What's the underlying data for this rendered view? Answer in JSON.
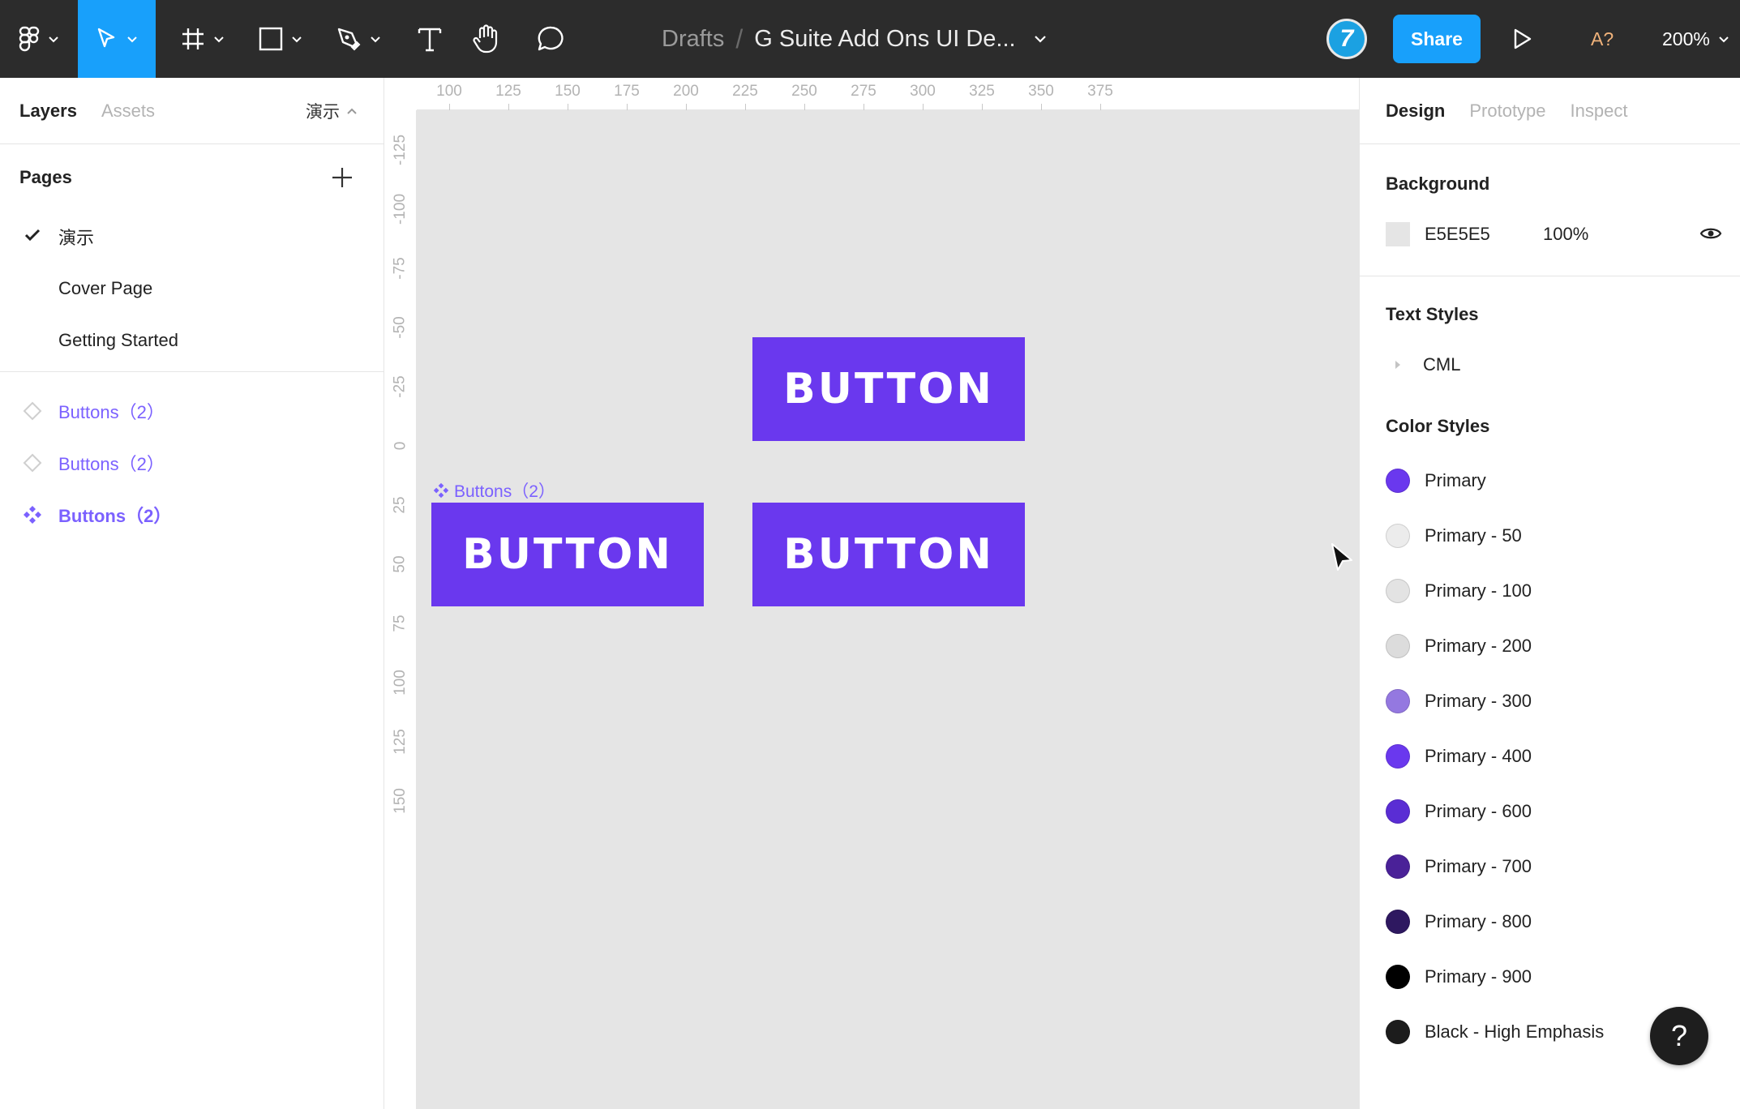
{
  "toolbar": {
    "breadcrumb_root": "Drafts",
    "breadcrumb_sep": "/",
    "document_title": "G Suite Add Ons UI De...",
    "avatar_initial": "7",
    "share_label": "Share",
    "a11y_label": "A?",
    "zoom_label": "200%",
    "icons": [
      "figma-menu-icon",
      "move-tool-icon",
      "frame-tool-icon",
      "shape-tool-icon",
      "pen-tool-icon",
      "text-tool-icon",
      "hand-tool-icon",
      "comment-tool-icon"
    ]
  },
  "left_panel": {
    "tabs": [
      "Layers",
      "Assets"
    ],
    "current_page_label": "演示",
    "pages_title": "Pages",
    "pages": [
      {
        "label": "演示",
        "selected": true
      },
      {
        "label": "Cover Page",
        "selected": false
      },
      {
        "label": "Getting Started",
        "selected": false
      }
    ],
    "layers": [
      {
        "label": "Buttons（2）",
        "icon": "component-variant-icon"
      },
      {
        "label": "Buttons（2）",
        "icon": "component-variant-icon"
      },
      {
        "label": "Buttons（2）",
        "icon": "component-set-icon"
      }
    ]
  },
  "canvas": {
    "ruler_x": [
      "100",
      "125",
      "150",
      "175",
      "200",
      "225",
      "250",
      "275",
      "300",
      "325",
      "350",
      "375"
    ],
    "ruler_y": [
      "-125",
      "-100",
      "-75",
      "-50",
      "-25",
      "0",
      "25",
      "50",
      "75",
      "100",
      "125",
      "150"
    ],
    "frame_label": "Buttons（2）",
    "buttons": [
      "BUTTON",
      "BUTTON",
      "BUTTON"
    ],
    "button_color": "#6a38ee"
  },
  "right_panel": {
    "tabs": [
      "Design",
      "Prototype",
      "Inspect"
    ],
    "background_title": "Background",
    "background_hex": "E5E5E5",
    "background_opacity": "100%",
    "text_styles_title": "Text Styles",
    "text_styles": [
      "CML"
    ],
    "color_styles_title": "Color Styles",
    "color_styles": [
      {
        "name": "Primary",
        "color": "#6a38ee"
      },
      {
        "name": "Primary - 50",
        "color": "#ececec"
      },
      {
        "name": "Primary - 100",
        "color": "#e3e3e3"
      },
      {
        "name": "Primary - 200",
        "color": "#dcdcdc"
      },
      {
        "name": "Primary - 300",
        "color": "#9478e0"
      },
      {
        "name": "Primary - 400",
        "color": "#6a38ee"
      },
      {
        "name": "Primary - 600",
        "color": "#5a2dd4"
      },
      {
        "name": "Primary - 700",
        "color": "#4a2198"
      },
      {
        "name": "Primary - 800",
        "color": "#2e1860"
      },
      {
        "name": "Primary - 900",
        "color": "#000000"
      },
      {
        "name": "Black - High Emphasis",
        "color": "#1c1c1c"
      }
    ]
  },
  "help_label": "?"
}
